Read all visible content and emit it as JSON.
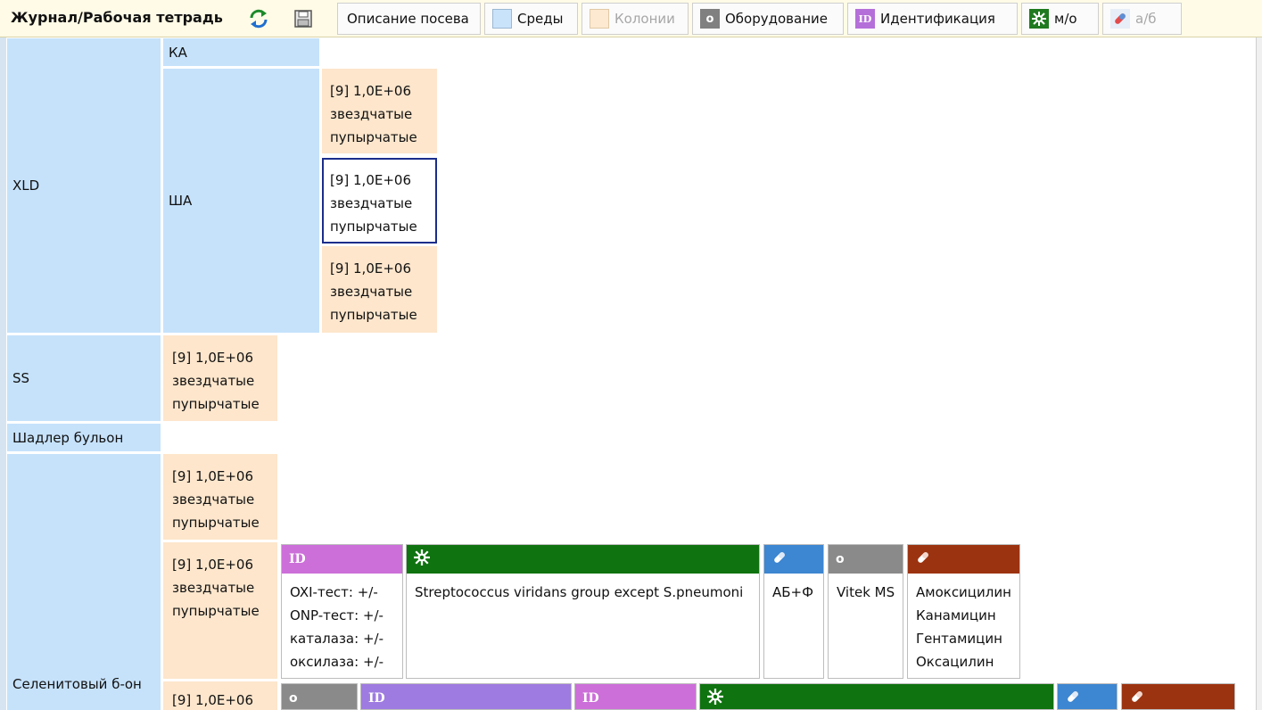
{
  "toolbar": {
    "title": "Журнал/Рабочая тетрадь",
    "refresh_icon": "refresh-icon",
    "save_icon": "save-icon",
    "buttons": {
      "seeding": "Описание посева",
      "media": "Среды",
      "colonies": "Колонии",
      "equipment": "Оборудование",
      "identification": "Идентификация",
      "microorganism": "м/о",
      "antibiotic": "а/б"
    },
    "colors": {
      "media": "#c6e2fb",
      "colonies": "#fde6cc",
      "equipment": "#808080",
      "identification": "#b56fd9",
      "microorganism": "#1f7a1f"
    }
  },
  "tree": {
    "media": {
      "xld": "XLD",
      "ka": "КА",
      "sha": "ША",
      "ss": "SS",
      "shadler": "Шадлер бульон",
      "selenite": "Селенитовый б-он"
    },
    "colony": {
      "line1": "[9] 1,0E+06",
      "line2": "звездчатые",
      "line3": "пупырчатые"
    }
  },
  "results": {
    "id_icon": "ID",
    "tests": [
      "OXI-тест: +/-",
      "ONP-тест: +/-",
      "каталаза: +/-",
      "оксилаза: +/-"
    ],
    "organism": "Streptococcus viridans group except S.pneumoni",
    "ab_method": "АБ+Ф",
    "equipment": "Vitek MS",
    "antibiotics": [
      "Амоксицилин",
      "Канамицин",
      "Гентамицин",
      "Оксацилин"
    ],
    "colors": {
      "identification": "#cc6fd9",
      "identification_alt": "#9e7be0",
      "microorganism": "#0f730f",
      "ab_method": "#3d86d1",
      "equipment": "#8a8a8a",
      "antibiotics": "#9c3310"
    }
  }
}
